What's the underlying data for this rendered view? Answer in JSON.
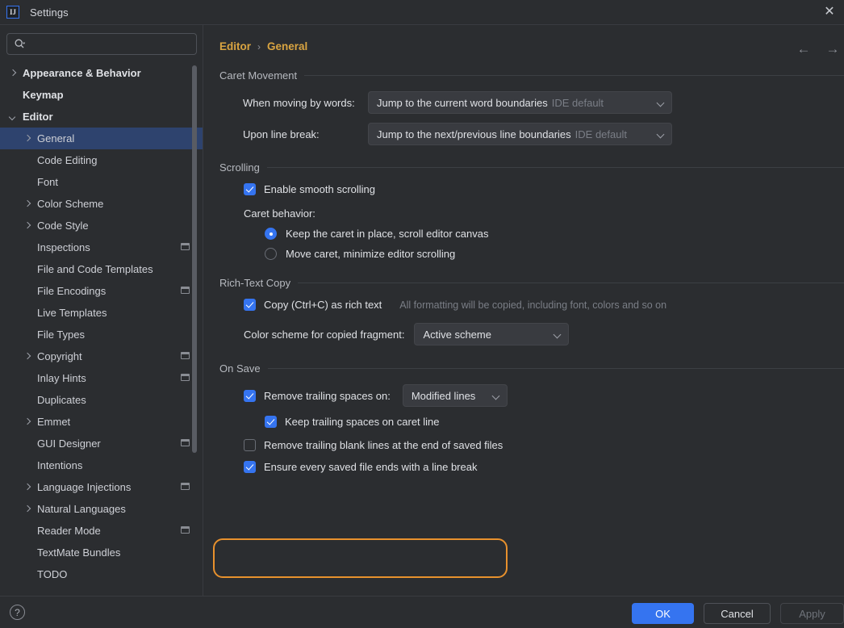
{
  "window": {
    "title": "Settings",
    "app_icon": "intellij-idea-icon",
    "close_icon": "close-icon"
  },
  "sidebar": {
    "search": {
      "placeholder": "",
      "value": "",
      "icon": "search-icon"
    },
    "items": [
      {
        "label": "Appearance & Behavior",
        "arrow": "right",
        "indent": 0,
        "bold": true,
        "selected": false,
        "cfg": false
      },
      {
        "label": "Keymap",
        "arrow": "none",
        "indent": 0,
        "bold": true,
        "selected": false,
        "cfg": false
      },
      {
        "label": "Editor",
        "arrow": "down",
        "indent": 0,
        "bold": true,
        "selected": false,
        "cfg": false
      },
      {
        "label": "General",
        "arrow": "right",
        "indent": 1,
        "bold": false,
        "selected": true,
        "cfg": false
      },
      {
        "label": "Code Editing",
        "arrow": "none",
        "indent": 1,
        "bold": false,
        "selected": false,
        "cfg": false
      },
      {
        "label": "Font",
        "arrow": "none",
        "indent": 1,
        "bold": false,
        "selected": false,
        "cfg": false
      },
      {
        "label": "Color Scheme",
        "arrow": "right",
        "indent": 1,
        "bold": false,
        "selected": false,
        "cfg": false
      },
      {
        "label": "Code Style",
        "arrow": "right",
        "indent": 1,
        "bold": false,
        "selected": false,
        "cfg": false
      },
      {
        "label": "Inspections",
        "arrow": "none",
        "indent": 1,
        "bold": false,
        "selected": false,
        "cfg": true
      },
      {
        "label": "File and Code Templates",
        "arrow": "none",
        "indent": 1,
        "bold": false,
        "selected": false,
        "cfg": false
      },
      {
        "label": "File Encodings",
        "arrow": "none",
        "indent": 1,
        "bold": false,
        "selected": false,
        "cfg": true
      },
      {
        "label": "Live Templates",
        "arrow": "none",
        "indent": 1,
        "bold": false,
        "selected": false,
        "cfg": false
      },
      {
        "label": "File Types",
        "arrow": "none",
        "indent": 1,
        "bold": false,
        "selected": false,
        "cfg": false
      },
      {
        "label": "Copyright",
        "arrow": "right",
        "indent": 1,
        "bold": false,
        "selected": false,
        "cfg": true
      },
      {
        "label": "Inlay Hints",
        "arrow": "none",
        "indent": 1,
        "bold": false,
        "selected": false,
        "cfg": true
      },
      {
        "label": "Duplicates",
        "arrow": "none",
        "indent": 1,
        "bold": false,
        "selected": false,
        "cfg": false
      },
      {
        "label": "Emmet",
        "arrow": "right",
        "indent": 1,
        "bold": false,
        "selected": false,
        "cfg": false
      },
      {
        "label": "GUI Designer",
        "arrow": "none",
        "indent": 1,
        "bold": false,
        "selected": false,
        "cfg": true
      },
      {
        "label": "Intentions",
        "arrow": "none",
        "indent": 1,
        "bold": false,
        "selected": false,
        "cfg": false
      },
      {
        "label": "Language Injections",
        "arrow": "right",
        "indent": 1,
        "bold": false,
        "selected": false,
        "cfg": true
      },
      {
        "label": "Natural Languages",
        "arrow": "right",
        "indent": 1,
        "bold": false,
        "selected": false,
        "cfg": false
      },
      {
        "label": "Reader Mode",
        "arrow": "none",
        "indent": 1,
        "bold": false,
        "selected": false,
        "cfg": true
      },
      {
        "label": "TextMate Bundles",
        "arrow": "none",
        "indent": 1,
        "bold": false,
        "selected": false,
        "cfg": false
      },
      {
        "label": "TODO",
        "arrow": "none",
        "indent": 1,
        "bold": false,
        "selected": false,
        "cfg": false
      }
    ]
  },
  "main": {
    "breadcrumb": {
      "root": "Editor",
      "separator": "›",
      "leaf": "General"
    },
    "nav": {
      "back": "←",
      "forward": "→"
    },
    "sections": {
      "caret_movement": {
        "title": "Caret Movement",
        "when_moving_label": "When moving by words:",
        "when_moving_value": "Jump to the current word boundaries",
        "when_moving_suffix": "IDE default",
        "upon_line_break_label": "Upon line break:",
        "upon_line_break_value": "Jump to the next/previous line boundaries",
        "upon_line_break_suffix": "IDE default"
      },
      "scrolling": {
        "title": "Scrolling",
        "smooth_scrolling_label": "Enable smooth scrolling",
        "smooth_scrolling_checked": true,
        "caret_behavior_label": "Caret behavior:",
        "radio_keep_label": "Keep the caret in place, scroll editor canvas",
        "radio_keep_selected": true,
        "radio_move_label": "Move caret, minimize editor scrolling",
        "radio_move_selected": false
      },
      "rich_text_copy": {
        "title": "Rich-Text Copy",
        "copy_label": "Copy (Ctrl+C) as rich text",
        "copy_checked": true,
        "copy_hint": "All formatting will be copied, including font, colors and so on",
        "scheme_label": "Color scheme for copied fragment:",
        "scheme_value": "Active scheme"
      },
      "on_save": {
        "title": "On Save",
        "remove_trailing_spaces_label": "Remove trailing spaces on:",
        "remove_trailing_spaces_checked": true,
        "remove_trailing_spaces_value": "Modified lines",
        "keep_trailing_spaces_label": "Keep trailing spaces on caret line",
        "keep_trailing_spaces_checked": true,
        "remove_blank_lines_label": "Remove trailing blank lines at the end of saved files",
        "remove_blank_lines_checked": false,
        "ensure_line_break_label": "Ensure every saved file ends with a line break",
        "ensure_line_break_checked": true
      }
    }
  },
  "footer": {
    "help_label": "?",
    "ok_label": "OK",
    "cancel_label": "Cancel",
    "apply_label": "Apply"
  },
  "colors": {
    "accent_blue": "#3574f0",
    "selection_blue": "#2e436e",
    "breadcrumb_gold": "#d9a441",
    "highlight_orange": "#e8912d",
    "background": "#2b2d30"
  }
}
